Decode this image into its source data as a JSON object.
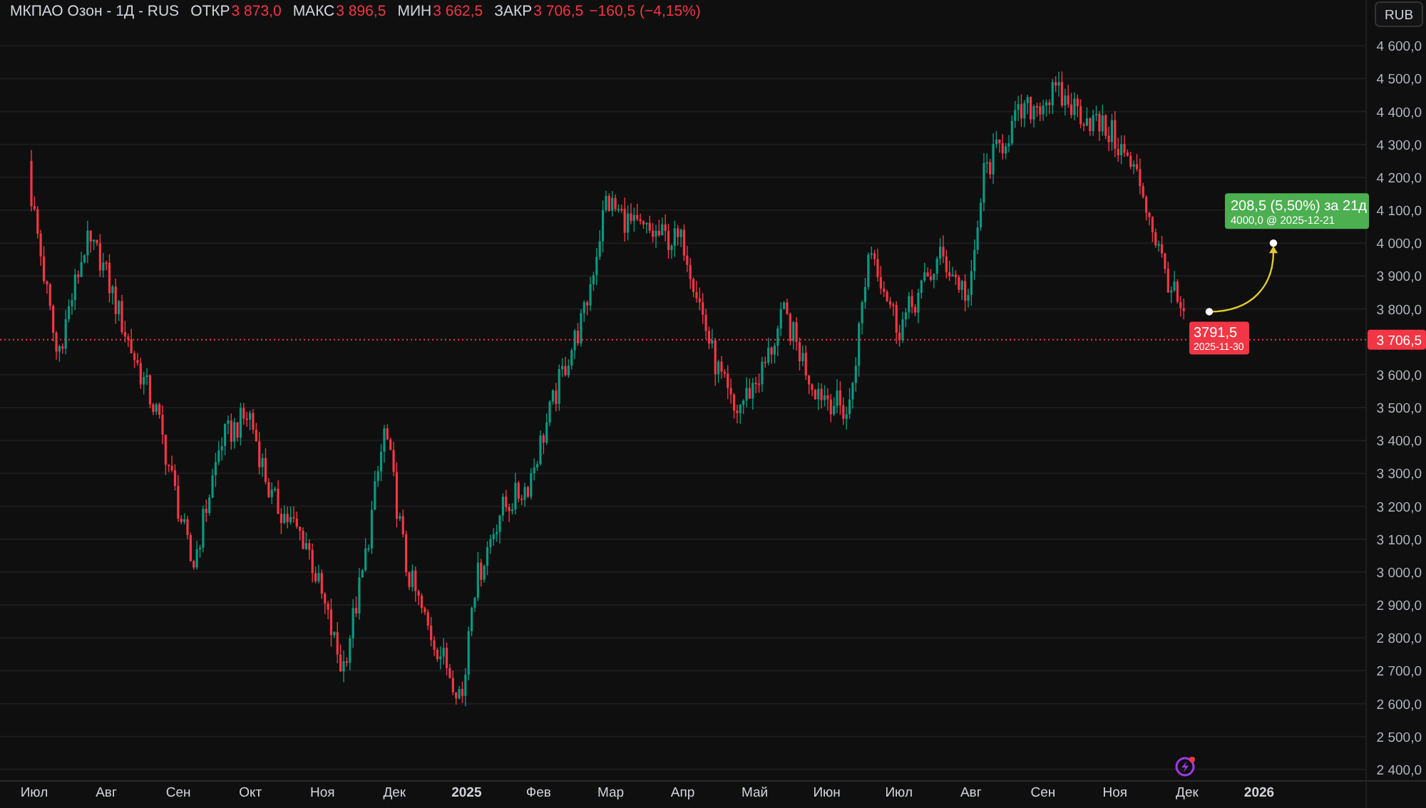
{
  "legend": {
    "symbol": "МКПАО Озон - 1Д - RUS",
    "fields": [
      {
        "label": "ОТКР",
        "value": "3 873,0"
      },
      {
        "label": "МАКС",
        "value": "3 896,5"
      },
      {
        "label": "МИН",
        "value": "3 662,5"
      },
      {
        "label": "ЗАКР",
        "value": "3 706,5"
      }
    ],
    "change": "−160,5 (−4,15%)"
  },
  "currency_button": "RUB",
  "price_axis": [
    "4 600,0",
    "4 500,0",
    "4 400,0",
    "4 300,0",
    "4 200,0",
    "4 100,0",
    "4 000,0",
    "3 900,0",
    "3 800,0",
    "3 600,0",
    "3 500,0",
    "3 400,0",
    "3 300,0",
    "3 200,0",
    "3 100,0",
    "3 000,0",
    "2 900,0",
    "2 800,0",
    "2 700,0",
    "2 600,0",
    "2 500,0",
    "2 400,0"
  ],
  "time_axis": [
    {
      "label": "Июл",
      "kind": "month"
    },
    {
      "label": "Авг",
      "kind": "month"
    },
    {
      "label": "Сен",
      "kind": "month"
    },
    {
      "label": "Окт",
      "kind": "month"
    },
    {
      "label": "Ноя",
      "kind": "month"
    },
    {
      "label": "Дек",
      "kind": "month"
    },
    {
      "label": "2025",
      "kind": "year"
    },
    {
      "label": "Фев",
      "kind": "month"
    },
    {
      "label": "Мар",
      "kind": "month"
    },
    {
      "label": "Апр",
      "kind": "month"
    },
    {
      "label": "Май",
      "kind": "month"
    },
    {
      "label": "Июн",
      "kind": "month"
    },
    {
      "label": "Июл",
      "kind": "month"
    },
    {
      "label": "Авг",
      "kind": "month"
    },
    {
      "label": "Сен",
      "kind": "month"
    },
    {
      "label": "Ноя",
      "kind": "month"
    },
    {
      "label": "Дек",
      "kind": "month"
    },
    {
      "label": "2026",
      "kind": "year"
    }
  ],
  "last_price": "3 706,5",
  "forecast": {
    "price": "3791,5",
    "date": "2025-11-30",
    "change": "208,5 (5,50%) за 21д",
    "target": "4000,0 @ 2025-12-21"
  }
}
